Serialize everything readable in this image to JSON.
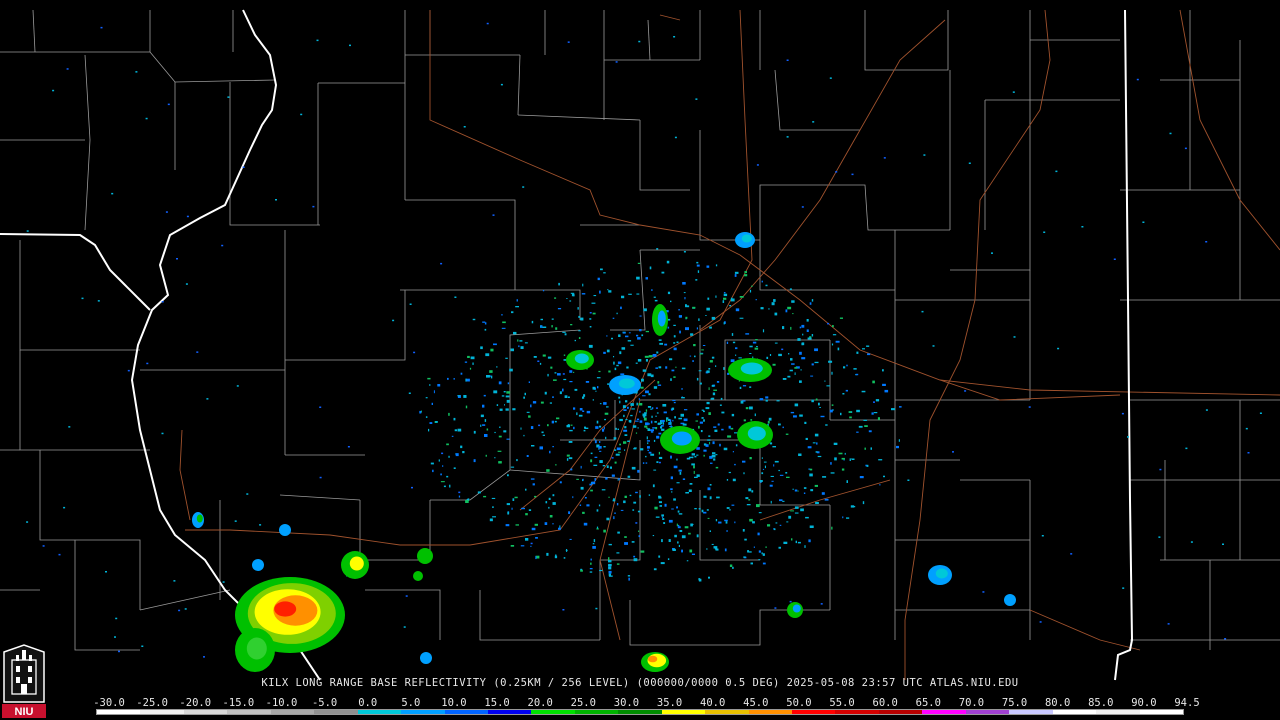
{
  "caption": "KILX LONG RANGE BASE REFLECTIVITY (0.25KM / 256 LEVEL) (000000/0000 0.5 DEG) 2025-05-08 23:57 UTC  ATLAS.NIU.EDU",
  "logo": {
    "text": "NIU",
    "icon": "niu-logo-icon"
  },
  "colorscale": {
    "labels": [
      "-30.0",
      "-25.0",
      "-20.0",
      "-15.0",
      "-10.0",
      "-5.0",
      "0.0",
      "5.0",
      "10.0",
      "15.0",
      "20.0",
      "25.0",
      "30.0",
      "35.0",
      "40.0",
      "45.0",
      "50.0",
      "55.0",
      "60.0",
      "65.0",
      "70.0",
      "75.0",
      "80.0",
      "85.0",
      "90.0",
      "94.5"
    ],
    "colors": [
      "#ffffff",
      "#f0f0f0",
      "#d8d8d8",
      "#c0c0c0",
      "#a8a8a8",
      "#909090",
      "#00c8d8",
      "#00a0ff",
      "#0064ff",
      "#0000f0",
      "#00e000",
      "#00b400",
      "#008c00",
      "#ffff00",
      "#e8c000",
      "#ff9000",
      "#ff0000",
      "#d40000",
      "#b80000",
      "#ff00ff",
      "#a040d0",
      "#c8c8ff",
      "#ffffff",
      "#f0f0f0",
      "#ffffff"
    ]
  },
  "map": {
    "background": "#000000",
    "county_color": "#9a9a9a",
    "state_color": "#ffffff",
    "highway_color": "#a0522d"
  }
}
